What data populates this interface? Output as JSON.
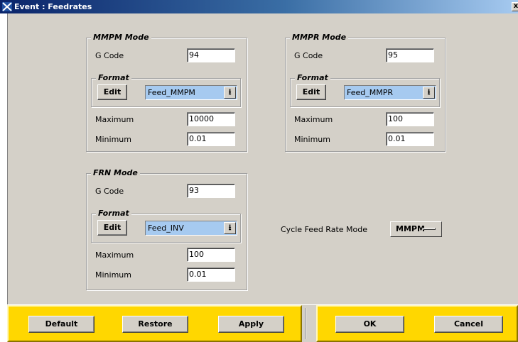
{
  "window": {
    "title": "Event : Feedrates",
    "close_glyph": "x"
  },
  "mmpm": {
    "title": "MMPM Mode",
    "gcode_label": "G Code",
    "gcode_value": "94",
    "format_title": "Format",
    "edit_label": "Edit",
    "format_value": "Feed_MMPM",
    "max_label": "Maximum",
    "max_value": "10000",
    "min_label": "Minimum",
    "min_value": "0.01"
  },
  "mmpr": {
    "title": "MMPR Mode",
    "gcode_label": "G Code",
    "gcode_value": "95",
    "format_title": "Format",
    "edit_label": "Edit",
    "format_value": "Feed_MMPR",
    "max_label": "Maximum",
    "max_value": "100",
    "min_label": "Minimum",
    "min_value": "0.01"
  },
  "frn": {
    "title": "FRN Mode",
    "gcode_label": "G Code",
    "gcode_value": "93",
    "format_title": "Format",
    "edit_label": "Edit",
    "format_value": "Feed_INV",
    "max_label": "Maximum",
    "max_value": "100",
    "min_label": "Minimum",
    "min_value": "0.01"
  },
  "cycle": {
    "label": "Cycle Feed Rate Mode",
    "value": "MMPM"
  },
  "actions": {
    "default_label": "Default",
    "restore_label": "Restore",
    "apply_label": "Apply",
    "ok_label": "OK",
    "cancel_label": "Cancel"
  },
  "colors": {
    "title_bar": "#0a246a",
    "dialog_bg": "#d4d0c8",
    "combo_bg": "#a6caf0",
    "action_bar": "#ffd700"
  },
  "icons": {
    "title_icon": "window-app-icon",
    "combo_arrow": "down-arrow-icon"
  }
}
